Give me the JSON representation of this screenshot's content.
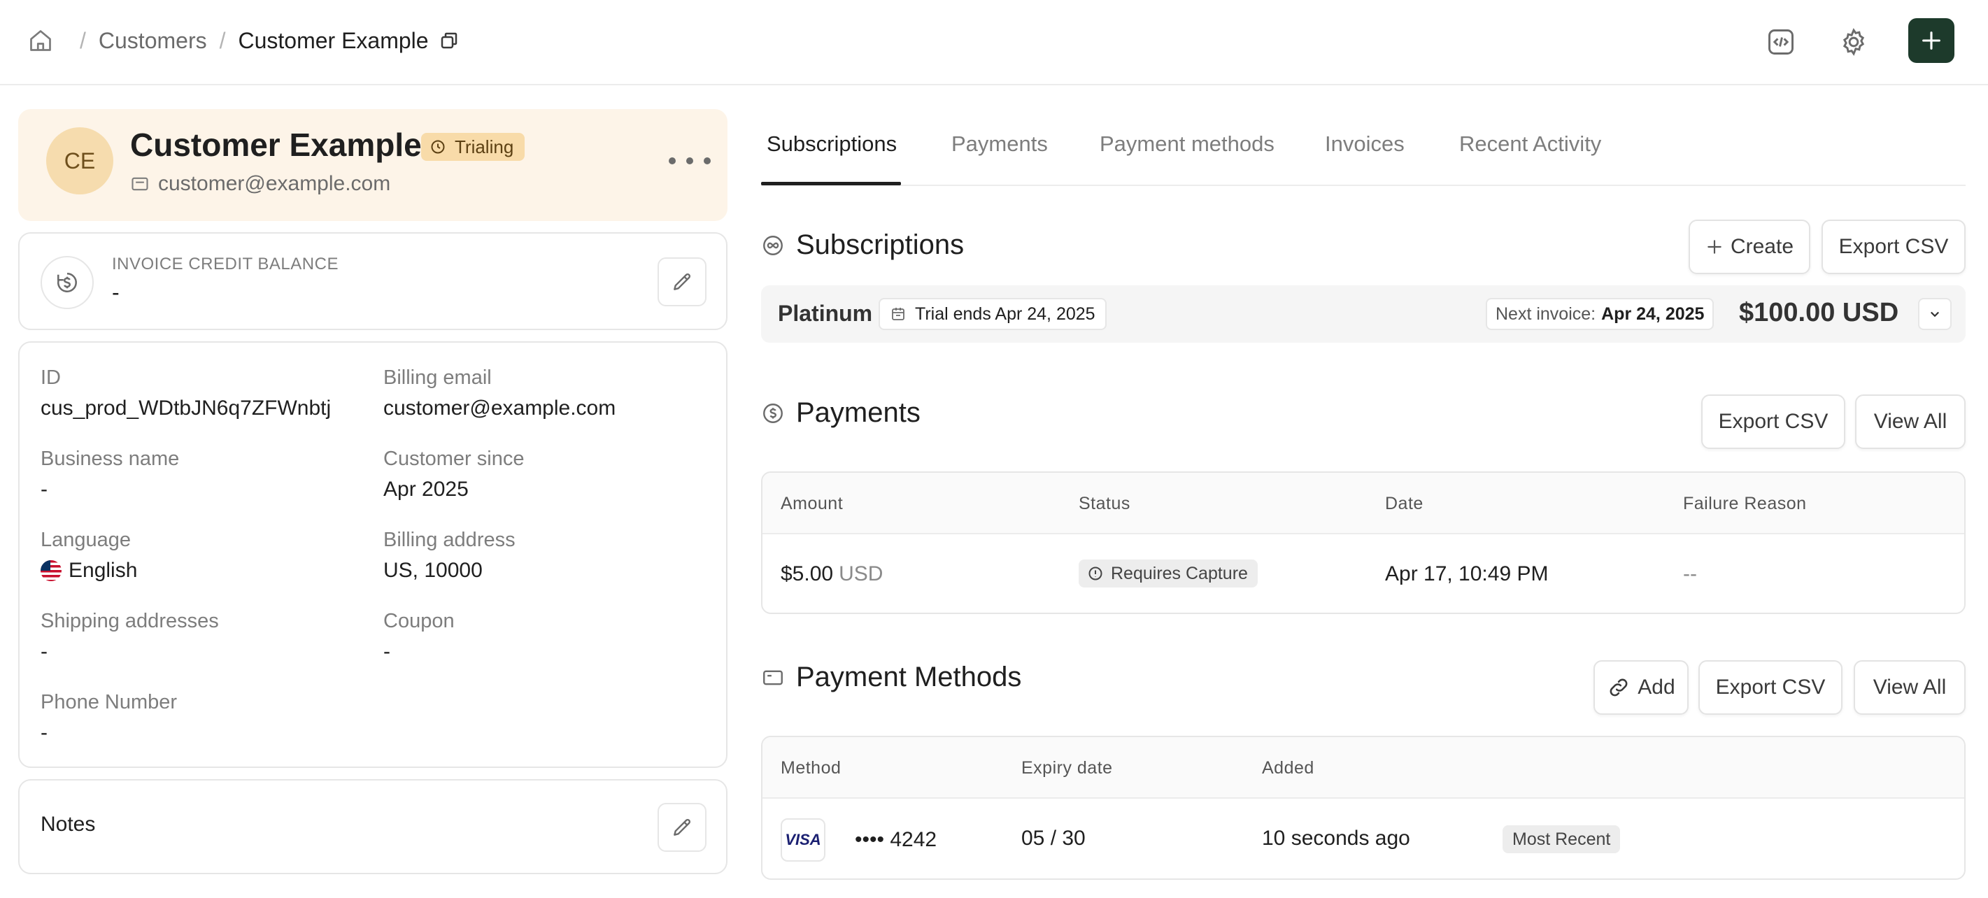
{
  "breadcrumb": {
    "home_icon": "home-icon",
    "items": [
      "Customers",
      "Customer Example"
    ],
    "separator": "/",
    "copy_icon": "copy-icon"
  },
  "header_actions": {
    "code_icon": "code-icon",
    "settings_icon": "gear-icon",
    "add_icon": "plus-icon"
  },
  "customer": {
    "initials": "CE",
    "name": "Customer Example",
    "status": "Trialing",
    "email": "customer@example.com"
  },
  "credit": {
    "label": "INVOICE CREDIT BALANCE",
    "value": "-"
  },
  "details": {
    "id": {
      "label": "ID",
      "value": "cus_prod_WDtbJN6q7ZFWnbtj"
    },
    "billing_email": {
      "label": "Billing email",
      "value": "customer@example.com"
    },
    "business_name": {
      "label": "Business name",
      "value": "-"
    },
    "customer_since": {
      "label": "Customer since",
      "value": "Apr 2025"
    },
    "language": {
      "label": "Language",
      "value": "English"
    },
    "billing_address": {
      "label": "Billing address",
      "value": "US, 10000"
    },
    "shipping": {
      "label": "Shipping addresses",
      "value": "-"
    },
    "coupon": {
      "label": "Coupon",
      "value": "-"
    },
    "phone": {
      "label": "Phone Number",
      "value": "-"
    }
  },
  "notes": {
    "title": "Notes"
  },
  "tabs": [
    "Subscriptions",
    "Payments",
    "Payment methods",
    "Invoices",
    "Recent Activity"
  ],
  "subscriptions": {
    "title": "Subscriptions",
    "create_label": "Create",
    "export_label": "Export CSV",
    "items": [
      {
        "plan": "Platinum",
        "trial": "Trial ends Apr 24, 2025",
        "next_label": "Next invoice:",
        "next_date": "Apr 24, 2025",
        "amount": "$100.00 USD"
      }
    ]
  },
  "payments": {
    "title": "Payments",
    "export_label": "Export CSV",
    "view_all_label": "View All",
    "columns": [
      "Amount",
      "Status",
      "Date",
      "Failure Reason"
    ],
    "rows": [
      {
        "amount": "$5.00",
        "currency": "USD",
        "status": "Requires Capture",
        "date": "Apr 17, 10:49 PM",
        "failure": "--"
      }
    ]
  },
  "payment_methods": {
    "title": "Payment Methods",
    "add_label": "Add",
    "export_label": "Export CSV",
    "view_all_label": "View All",
    "columns": [
      "Method",
      "Expiry date",
      "Added"
    ],
    "rows": [
      {
        "brand": "VISA",
        "last4": "•••• 4242",
        "expiry": "05 / 30",
        "added": "10 seconds ago",
        "tag": "Most Recent"
      }
    ]
  }
}
